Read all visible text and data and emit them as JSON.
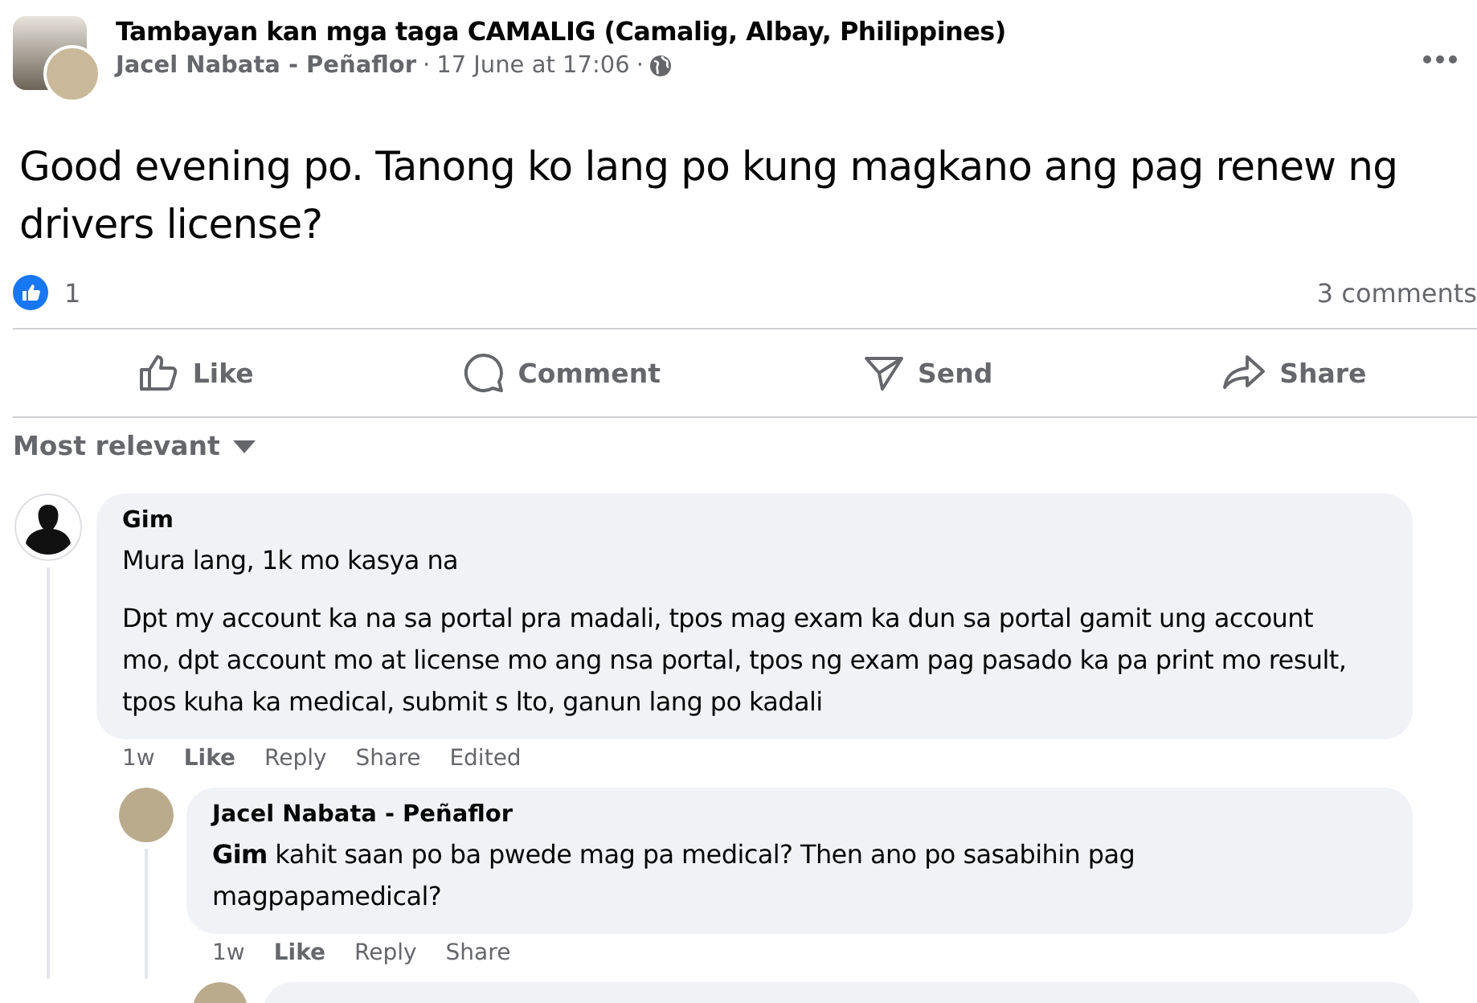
{
  "post": {
    "group": "Tambayan kan mga taga CAMALIG (Camalig, Albay, Philippines)",
    "author": "Jacel Nabata - Peñaflor",
    "date": "17 June at 17:06",
    "separator": "·",
    "text": "Good evening po. Tanong ko lang po kung magkano ang pag renew ng drivers license?"
  },
  "reactions": {
    "count": "1",
    "comments": "3 comments"
  },
  "actions": [
    {
      "kind": "like",
      "label": "Like"
    },
    {
      "kind": "comment",
      "label": "Comment"
    },
    {
      "kind": "send",
      "label": "Send"
    },
    {
      "kind": "share",
      "label": "Share"
    }
  ],
  "sort": {
    "label": "Most relevant"
  },
  "comments": [
    {
      "kind": "silhouette",
      "author": "Gim",
      "paragraphs": [
        "Mura lang, 1k mo kasya na",
        "Dpt my account ka na sa portal pra madali, tpos mag exam ka dun sa portal gamit ung account mo, dpt account mo at license mo ang nsa portal, tpos ng exam pag pasado ka pa print mo result, tpos kuha ka medical, submit s lto, ganun lang po kadali"
      ],
      "time": "1w",
      "links": [
        "Like",
        "Reply",
        "Share",
        "Edited"
      ],
      "replies": [
        {
          "kind": "photo",
          "author": "Jacel Nabata - Peñaflor",
          "paragraphs": [
            "**Gim** kahit saan po ba pwede mag pa medical? Then ano po sasabihin pag magpapamedical?"
          ],
          "time": "1w",
          "links": [
            "Like",
            "Reply",
            "Share"
          ]
        }
      ]
    }
  ]
}
